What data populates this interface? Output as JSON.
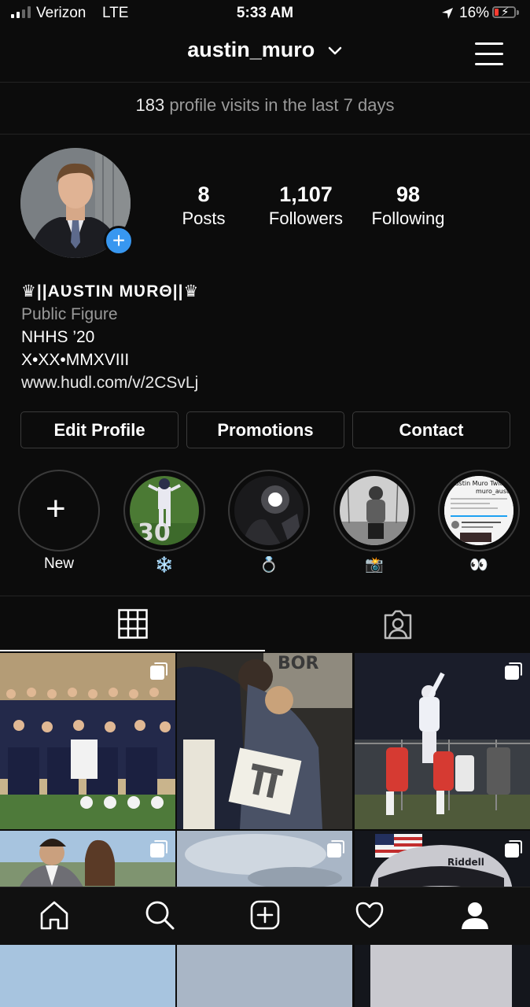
{
  "status_bar": {
    "carrier": "Verizon",
    "network": "LTE",
    "time": "5:33 AM",
    "battery_percent": "16%",
    "icons": [
      "signal-icon",
      "location-arrow-icon",
      "battery-charging-icon"
    ]
  },
  "header": {
    "username": "austin_muro",
    "icons": [
      "chevron-down-icon",
      "hamburger-menu-icon"
    ]
  },
  "insights": {
    "count": "183",
    "text": "profile visits in the last 7 days"
  },
  "profile": {
    "stats": [
      {
        "value": "8",
        "label": "Posts"
      },
      {
        "value": "1,107",
        "label": "Followers"
      },
      {
        "value": "98",
        "label": "Following"
      }
    ],
    "display_name": "♛||ΑƲSTIN MƲRΘ||♛",
    "category": "Public Figure",
    "bio_lines": [
      "NHHS ’20",
      "X•XX•MMXVIII"
    ],
    "website": "www.hudl.com/v/2CSvLj"
  },
  "buttons": {
    "edit_profile": "Edit Profile",
    "promotions": "Promotions",
    "contact": "Contact"
  },
  "highlights": [
    {
      "label": "New"
    },
    {
      "label": "❄️"
    },
    {
      "label": "💍"
    },
    {
      "label": "📸"
    },
    {
      "label": "👀"
    }
  ],
  "highlight_text": {
    "twitter_title": "Austin Muro  Twitter",
    "twitter_handle": "muro_austin"
  },
  "tabs": [
    {
      "name": "grid",
      "icon": "grid-icon",
      "selected": true
    },
    {
      "name": "tagged",
      "icon": "tagged-person-icon",
      "selected": false
    }
  ],
  "posts": [
    {
      "kind": "team-photo",
      "multi": true
    },
    {
      "kind": "couple-photo",
      "multi": false,
      "sign_text": "BOR"
    },
    {
      "kind": "football-catch",
      "multi": true
    },
    {
      "kind": "formal-photo",
      "multi": true
    },
    {
      "kind": "sky-photo",
      "multi": true
    },
    {
      "kind": "helmet-photo",
      "multi": true,
      "helmet_brand": "Riddell"
    }
  ],
  "bottom_nav": [
    "home-icon",
    "search-icon",
    "new-post-icon",
    "activity-heart-icon",
    "profile-icon"
  ],
  "colors": {
    "background": "#0c0c0c",
    "accent_blue": "#3897f0",
    "muted_text": "#9a9a9a",
    "battery_low": "#ff3b30"
  }
}
